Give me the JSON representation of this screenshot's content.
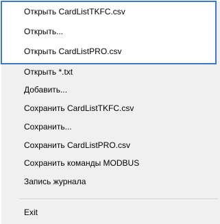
{
  "menu": {
    "items": [
      {
        "label": "Открыть CardListTKFC.csv"
      },
      {
        "label": "Открыть..."
      },
      {
        "label": "Открыть CardListPRO.csv"
      },
      {
        "label": "Открыть *.txt"
      },
      {
        "label": "Добавить..."
      },
      {
        "label": "Сохранить CardListTKFC.csv"
      },
      {
        "label": "Сохранить..."
      },
      {
        "label": "Сохранить CardListPRO.csv"
      },
      {
        "label": "Сохранить команды MODBUS"
      },
      {
        "label": "Запись журнала"
      },
      {
        "label": "Exit"
      }
    ]
  },
  "colors": {
    "menu_background": "#f0f0f0",
    "highlight_border": "#3c78c8",
    "separator": "#c8c8c8",
    "text": "#000000"
  }
}
